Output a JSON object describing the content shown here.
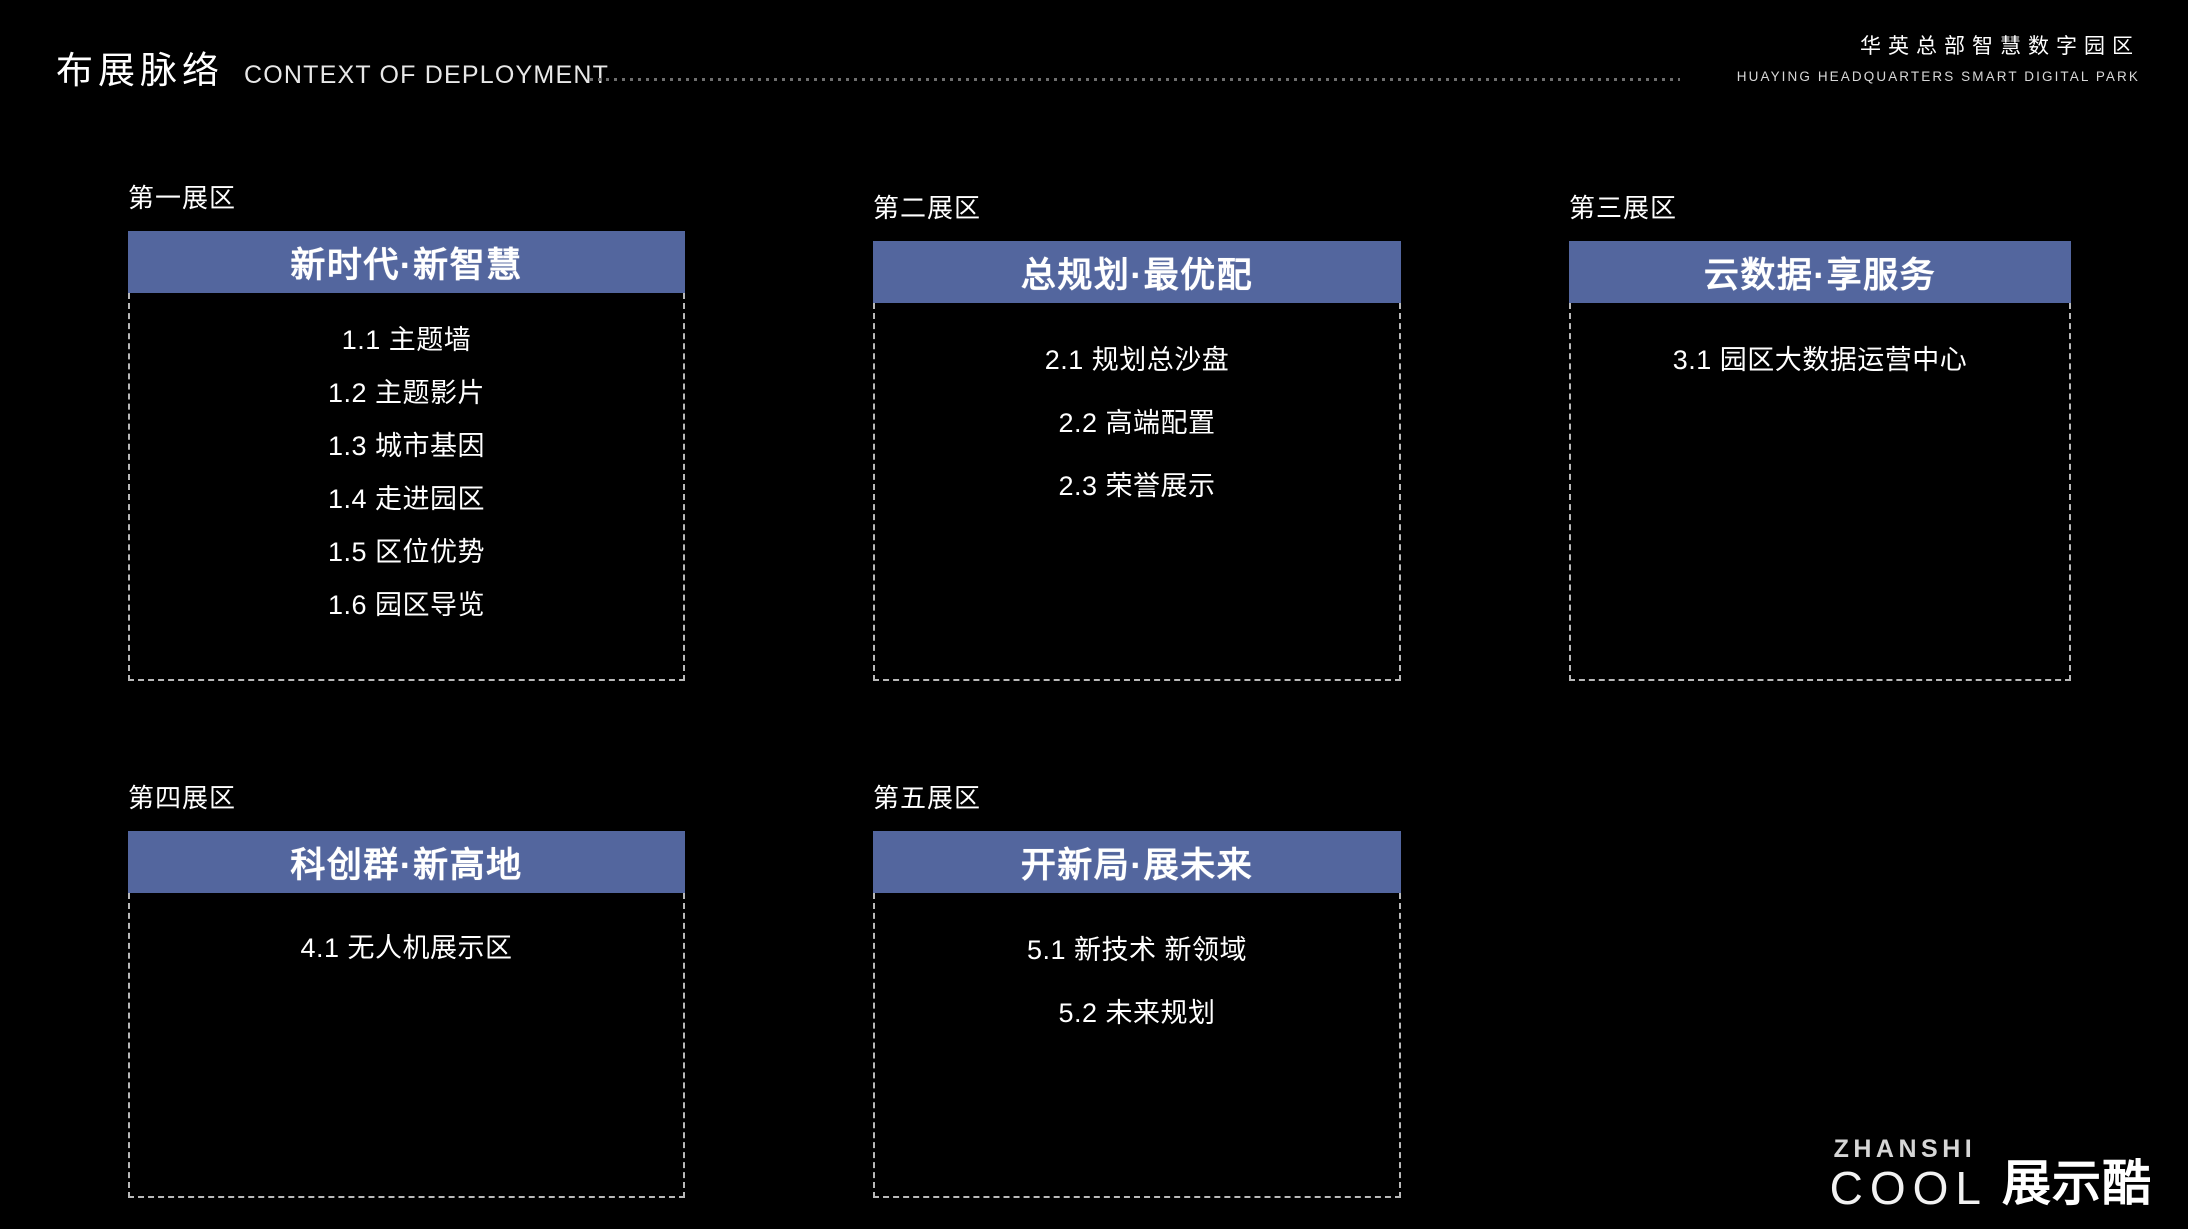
{
  "header": {
    "title_cn": "布展脉络",
    "title_en": "CONTEXT OF DEPLOYMENT",
    "brand_cn": "华英总部智慧数字园区",
    "brand_en": "HUAYING HEADQUARTERS SMART DIGITAL PARK"
  },
  "colors": {
    "background": "#000000",
    "zone_header": "#53669e",
    "dashed_border": "#b9b9b9",
    "text": "#ffffff"
  },
  "zones": [
    {
      "label": "第一展区",
      "title": "新时代·新智慧",
      "items": [
        "1.1 主题墙",
        "1.2 主题影片",
        "1.3 城市基因",
        "1.4 走进园区",
        "1.5 区位优势",
        "1.6 园区导览"
      ]
    },
    {
      "label": "第二展区",
      "title": "总规划·最优配",
      "items": [
        "2.1 规划总沙盘",
        "2.2 高端配置",
        "2.3 荣誉展示"
      ]
    },
    {
      "label": "第三展区",
      "title": "云数据·享服务",
      "items": [
        "3.1 园区大数据运营中心"
      ]
    },
    {
      "label": "第四展区",
      "title": "科创群·新高地",
      "items": [
        "4.1 无人机展示区"
      ]
    },
    {
      "label": "第五展区",
      "title": "开新局·展未来",
      "items": [
        "5.1 新技术 新领域",
        "5.2 未来规划"
      ]
    }
  ],
  "footer": {
    "logo_zhanshi": "ZHANSHI",
    "logo_cool": "COOL",
    "logo_cn": "展示酷"
  }
}
